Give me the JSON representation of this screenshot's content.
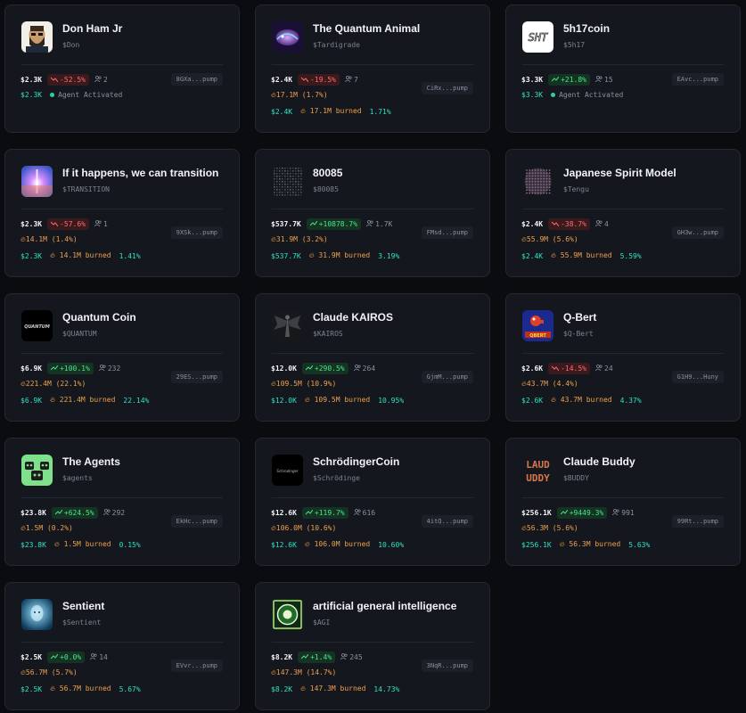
{
  "cards": [
    {
      "name": "Don Ham Jr",
      "ticker": "$Don",
      "market_cap": "$2.3K",
      "change": "-52.5%",
      "holders": "2",
      "address": "8GXa...pump",
      "teal_mc": "$2.3K",
      "status": "Agent Activated",
      "logo_icon": "bearded-man-portrait-icon"
    },
    {
      "name": "The Quantum Animal",
      "ticker": "$Tardigrade",
      "market_cap": "$2.4K",
      "change": "-19.5%",
      "holders": "7",
      "address": "CiRx...pump",
      "burn": "17.1M (1.7%)",
      "teal_mc": "$2.4K",
      "burned_amount": "17.1M burned",
      "burned_pct": "1.71%",
      "logo_icon": "purple-quantum-creature-icon"
    },
    {
      "name": "5h17coin",
      "ticker": "$5h17",
      "market_cap": "$3.3K",
      "change": "+21.8%",
      "holders": "15",
      "address": "EAvc...pump",
      "teal_mc": "$3.3K",
      "status": "Agent Activated",
      "logo_icon": "shit-text-logo-icon"
    },
    {
      "name": "If it happens, we can transition",
      "ticker": "$TRANSITION",
      "market_cap": "$2.3K",
      "change": "-57.6%",
      "holders": "1",
      "address": "9XSk...pump",
      "burn": "14.1M (1.4%)",
      "teal_mc": "$2.3K",
      "burned_amount": "14.1M burned",
      "burned_pct": "1.41%",
      "logo_icon": "light-burst-icon"
    },
    {
      "name": "80085",
      "ticker": "$80085",
      "market_cap": "$537.7K",
      "change": "+10878.7%",
      "holders": "1.7K",
      "address": "FMsd...pump",
      "burn": "31.9M (3.2%)",
      "teal_mc": "$537.7K",
      "burned_amount": "31.9M burned",
      "burned_pct": "3.19%",
      "logo_icon": "ascii-pattern-icon"
    },
    {
      "name": "Japanese Spirit Model",
      "ticker": "$Tengu",
      "market_cap": "$2.4K",
      "change": "-38.7%",
      "holders": "4",
      "address": "GH3w...pump",
      "burn": "55.9M (5.6%)",
      "teal_mc": "$2.4K",
      "burned_amount": "55.9M burned",
      "burned_pct": "5.59%",
      "logo_icon": "dotted-sphere-icon"
    },
    {
      "name": "Quantum Coin",
      "ticker": "$QUANTUM",
      "market_cap": "$6.9K",
      "change": "+100.1%",
      "holders": "232",
      "address": "29ES...pump",
      "burn": "221.4M (22.1%)",
      "teal_mc": "$6.9K",
      "burned_amount": "221.4M burned",
      "burned_pct": "22.14%",
      "logo_icon": "quantum-wordmark-icon"
    },
    {
      "name": "Claude KAIROS",
      "ticker": "$KAIROS",
      "market_cap": "$12.0K",
      "change": "+290.5%",
      "holders": "264",
      "address": "GjmM...pump",
      "burn": "109.5M (10.9%)",
      "teal_mc": "$12.0K",
      "burned_amount": "109.5M burned",
      "burned_pct": "10.95%",
      "logo_icon": "winged-figure-icon"
    },
    {
      "name": "Q-Bert",
      "ticker": "$Q-Bert",
      "market_cap": "$2.6K",
      "change": "-14.5%",
      "holders": "24",
      "address": "G1H9...Huny",
      "burn": "43.7M (4.4%)",
      "teal_mc": "$2.6K",
      "burned_amount": "43.7M burned",
      "burned_pct": "4.37%",
      "logo_icon": "qbert-character-icon"
    },
    {
      "name": "The Agents",
      "ticker": "$agents",
      "market_cap": "$23.8K",
      "change": "+624.5%",
      "holders": "292",
      "address": "EkHc...pump",
      "burn": "1.5M (0.2%)",
      "teal_mc": "$23.8K",
      "burned_amount": "1.5M burned",
      "burned_pct": "0.15%",
      "logo_icon": "robot-faces-icon"
    },
    {
      "name": "SchrödingerCoin",
      "ticker": "$Schrödinge",
      "market_cap": "$12.6K",
      "change": "+119.7%",
      "holders": "616",
      "address": "4itQ...pump",
      "burn": "106.0M (10.6%)",
      "teal_mc": "$12.6K",
      "burned_amount": "106.0M burned",
      "burned_pct": "10.60%",
      "logo_icon": "schrodinger-wordmark-icon"
    },
    {
      "name": "Claude Buddy",
      "ticker": "$BUDDY",
      "market_cap": "$256.1K",
      "change": "+9449.3%",
      "holders": "991",
      "address": "99Rt...pump",
      "burn": "56.3M (5.6%)",
      "teal_mc": "$256.1K",
      "burned_amount": "56.3M burned",
      "burned_pct": "5.63%",
      "logo_icon": "claude-buddy-pixel-text-icon"
    },
    {
      "name": "Sentient",
      "ticker": "$Sentient",
      "market_cap": "$2.5K",
      "change": "+0.0%",
      "holders": "14",
      "address": "EVvr...pump",
      "burn": "56.7M (5.7%)",
      "teal_mc": "$2.5K",
      "burned_amount": "56.7M burned",
      "burned_pct": "5.67%",
      "logo_icon": "glowing-head-icon"
    },
    {
      "name": "artificial general intelligence",
      "ticker": "$AGI",
      "market_cap": "$8.2K",
      "change": "+1.4%",
      "holders": "245",
      "address": "3NqR...pump",
      "burn": "147.3M (14.7%)",
      "teal_mc": "$8.2K",
      "burned_amount": "147.3M burned",
      "burned_pct": "14.73%",
      "logo_icon": "green-emblem-icon"
    }
  ],
  "colors": {
    "teal": "#31e0c0",
    "orange": "#f0a04b",
    "red": "#ff6b70",
    "green": "#4be38a"
  }
}
